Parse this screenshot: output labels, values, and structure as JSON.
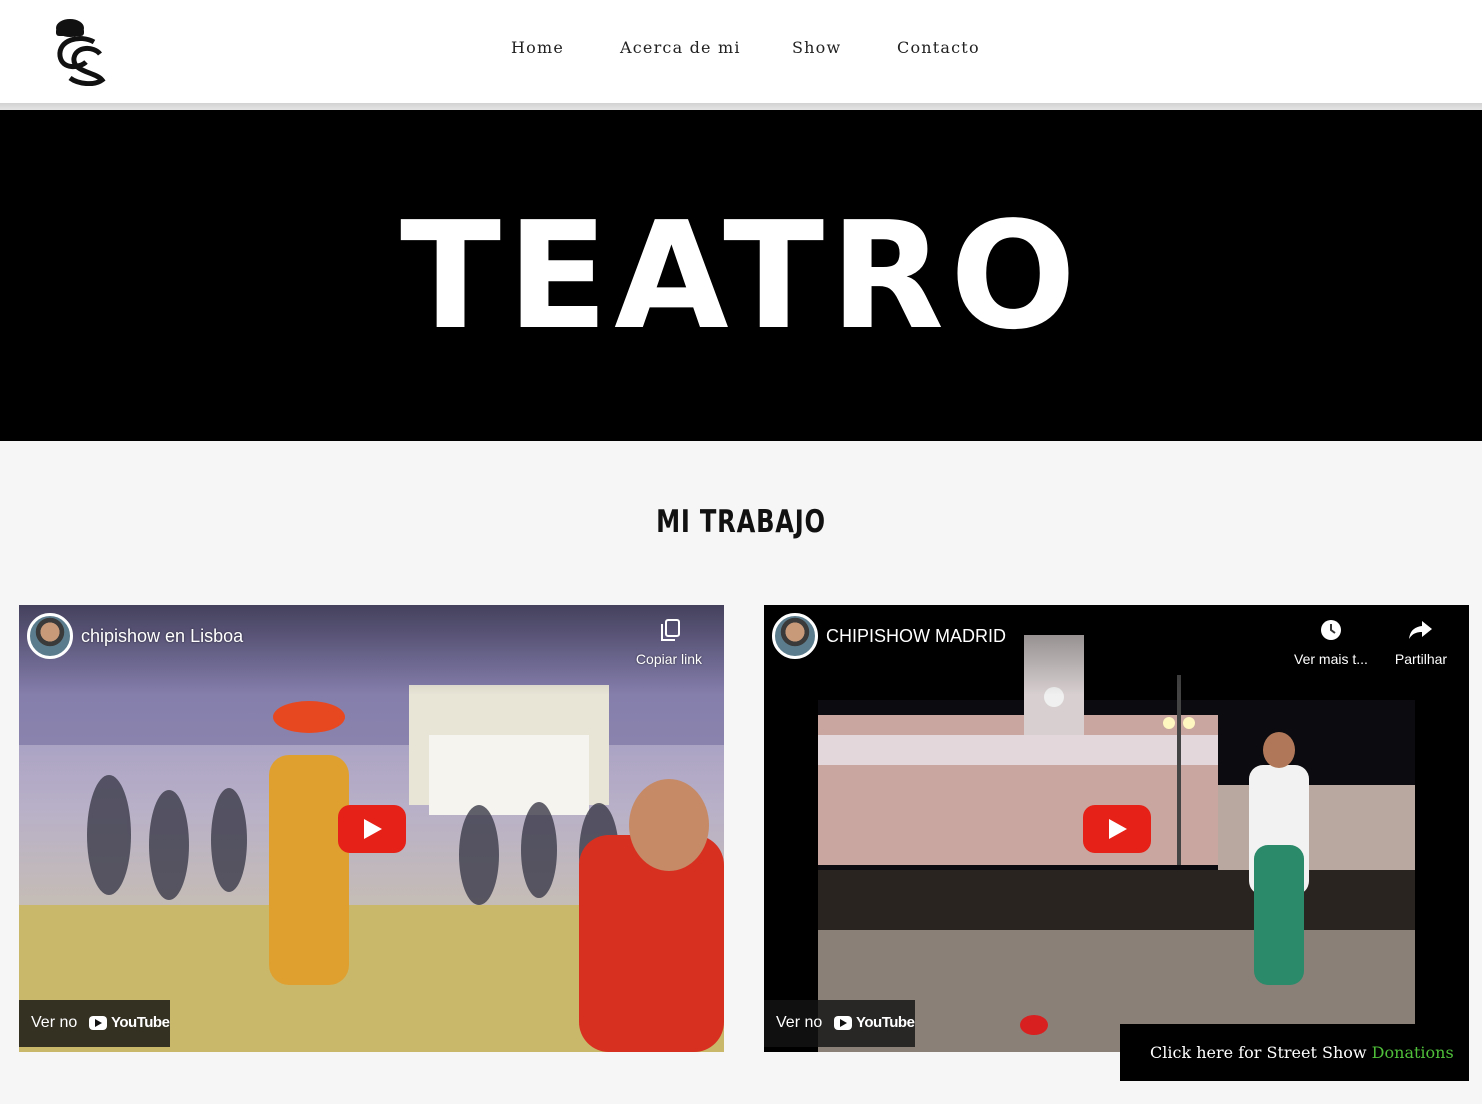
{
  "nav": {
    "items": [
      {
        "label": "Home"
      },
      {
        "label": "Acerca de mi"
      },
      {
        "label": "Show"
      },
      {
        "label": "Contacto"
      }
    ]
  },
  "hero": {
    "title": "TEATRO"
  },
  "section": {
    "title": "MI TRABAJO"
  },
  "videos": [
    {
      "title": "chipishow en Lisboa",
      "actions": [
        {
          "label": "Copiar link",
          "icon": "copy-icon"
        }
      ],
      "watch_label": "Ver no",
      "platform": "YouTube"
    },
    {
      "title": "CHIPISHOW MADRID",
      "actions": [
        {
          "label": "Ver mais t...",
          "icon": "clock-icon"
        },
        {
          "label": "Partilhar",
          "icon": "share-icon"
        }
      ],
      "watch_label": "Ver no",
      "platform": "YouTube"
    }
  ],
  "donate": {
    "text": "Click here for Street Show",
    "link_label": "Donations",
    "link_color": "#4fbf3a"
  },
  "colors": {
    "play_button": "#e62117",
    "header_bg": "#ffffff",
    "hero_bg": "#000000"
  }
}
